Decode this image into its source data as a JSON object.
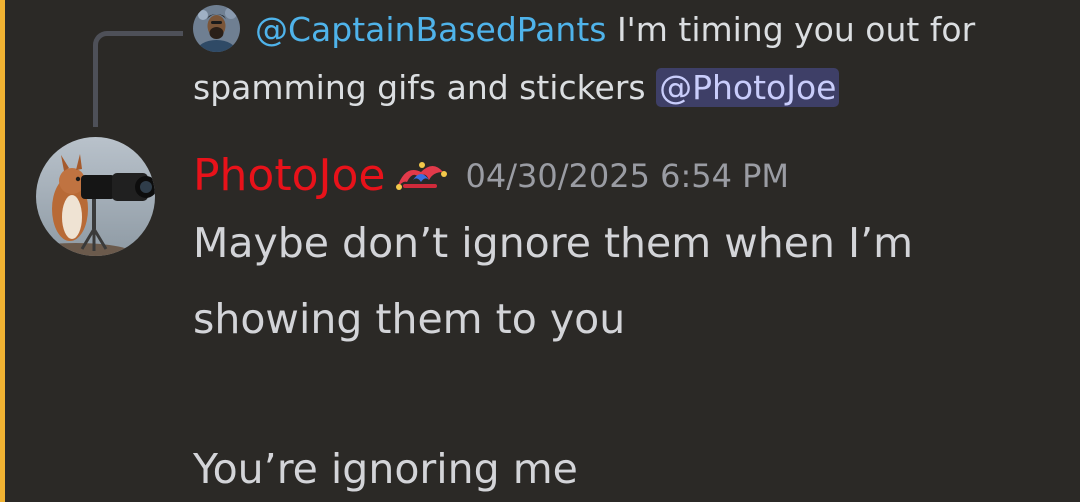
{
  "reply": {
    "author": "@CaptainBasedPants",
    "text_line1": " I'm timing you out for",
    "text_line2": "spamming gifs and stickers ",
    "mention": "@PhotoJoe"
  },
  "message": {
    "username": "PhotoJoe",
    "username_color": "#e8121a",
    "timestamp": "04/30/2025 6:54 PM",
    "lines": [
      "Maybe don’t ignore them when I’m",
      "showing them to you",
      "You’re ignoring me"
    ]
  },
  "icons": {
    "reply_avatar": "bearded-man-avatar",
    "avatar": "squirrel-with-camera-avatar",
    "role_icon": "jester-hat-icon"
  },
  "colors": {
    "accent_bar": "#f0b232",
    "reply_author": "#4fb3ea",
    "mention_bg": "#3e3f67"
  }
}
